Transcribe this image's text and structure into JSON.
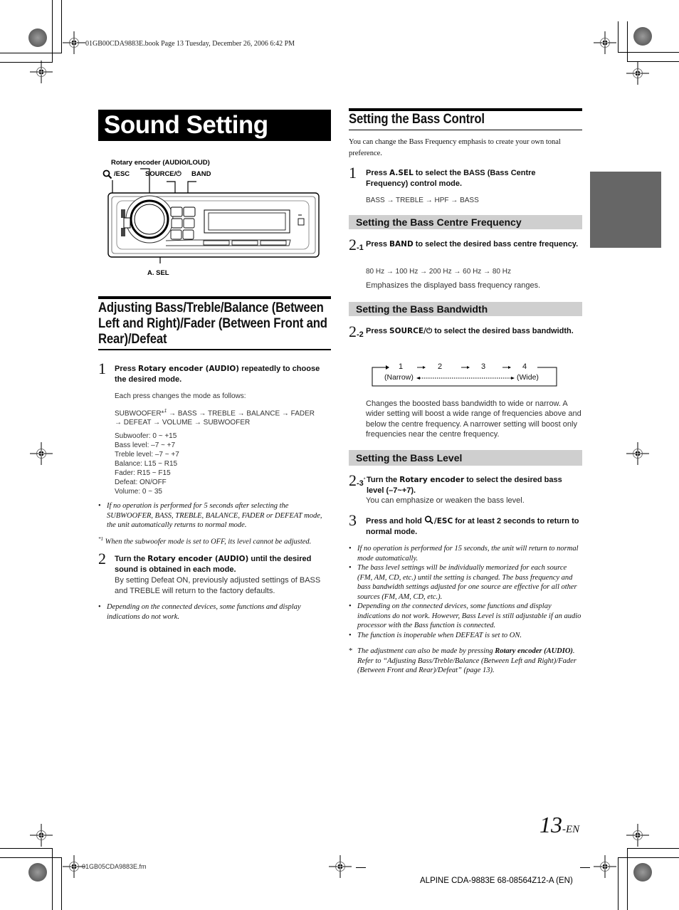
{
  "print_header": {
    "file_stamp": "01GB00CDA9883E.book  Page 13  Tuesday, December 26, 2006  6:42 PM"
  },
  "left": {
    "title": "Sound Setting",
    "diagram": {
      "labels": {
        "rotary": "Rotary encoder (AUDIO/LOUD)",
        "esc": "/ESC",
        "source": "SOURCE/⏻",
        "band": "BAND",
        "asel": "A. SEL"
      }
    },
    "section_heading": "Adjusting Bass/Treble/Balance (Between Left and Right)/Fader (Between Front and Rear)/Defeat",
    "step1": {
      "num": "1",
      "pre": "Press ",
      "key": "Rotary encoder (AUDIO)",
      "post": " repeatedly to choose the desired mode.",
      "intro": "Each press changes the mode as follows:",
      "sequence_line1": "SUBWOOFER*",
      "sequence_sup": "1",
      "sequence_rest": " → BASS → TREBLE → BALANCE → FADER",
      "sequence_line2": "→ DEFEAT → VOLUME → SUBWOOFER",
      "ranges": [
        "Subwoofer: 0 ~ +15",
        "Bass level: –7 ~ +7",
        "Treble level: –7 ~ +7",
        "Balance: L15 ~ R15",
        "Fader: R15 ~ F15",
        "Defeat: ON/OFF",
        "Volume: 0 ~ 35"
      ]
    },
    "note1": "If no operation is performed for 5 seconds after selecting the SUBWOOFER, BASS, TREBLE, BALANCE, FADER or DEFEAT mode, the unit automatically returns to normal mode.",
    "footnote_mark": "*1",
    "footnote": "When the subwoofer mode is set to OFF, its level cannot be adjusted.",
    "step2": {
      "num": "2",
      "pre": "Turn the ",
      "key": "Rotary encoder (AUDIO)",
      "post": " until the desired sound is obtained in each mode.",
      "desc": "By setting Defeat ON, previously adjusted settings of BASS and TREBLE will return to the factory defaults."
    },
    "note2": "Depending on the connected devices, some functions and display indications do not work."
  },
  "right": {
    "heading": "Setting the Bass Control",
    "intro": "You can change the Bass Frequency emphasis to create your own tonal preference.",
    "step1": {
      "num": "1",
      "pre": "Press ",
      "key": "A.SEL",
      "post": " to select the BASS (Bass Centre Frequency) control mode.",
      "sequence": "BASS → TREBLE → HPF → BASS"
    },
    "sub1": {
      "title": "Setting the Bass Centre Frequency",
      "num": "2",
      "suffix": "-1",
      "pre": "Press ",
      "key": "BAND",
      "post": " to select the desired bass centre frequency.",
      "sequence": "80 Hz → 100 Hz → 200 Hz → 60 Hz → 80 Hz",
      "desc": "Emphasizes the displayed bass frequency ranges."
    },
    "sub2": {
      "title": "Setting the Bass Bandwidth",
      "num": "2",
      "suffix": "-2",
      "pre": "Press ",
      "key": "SOURCE/⏻",
      "post": " to select the desired bass bandwidth.",
      "cycle": {
        "steps": [
          "1",
          "2",
          "3",
          "4"
        ],
        "narrow": "(Narrow)",
        "wide": "(Wide)"
      },
      "desc": "Changes the boosted bass bandwidth to wide or narrow. A wider setting will boost a wide range of frequencies above and below the centre frequency. A narrower setting will boost only frequencies near the centre frequency."
    },
    "sub3": {
      "title": "Setting the Bass Level",
      "num": "2",
      "suffix": "-3",
      "star": "*",
      "pre": "Turn the ",
      "key": "Rotary encoder",
      "post": " to select the desired bass level (–7~+7).",
      "desc": "You can emphasize or weaken the bass level."
    },
    "step3": {
      "num": "3",
      "pre": "Press and hold ",
      "key": "/ESC",
      "post": " for at least 2 seconds to return to normal mode."
    },
    "notes": [
      "If no operation is performed for 15 seconds, the unit will return to normal mode automatically.",
      "The bass level settings will be individually memorized for each source (FM, AM, CD, etc.) until the setting is changed. The bass frequency and bass bandwidth settings adjusted for one source are effective for all other sources (FM, AM, CD, etc.).",
      "Depending on the connected devices, some functions and display indications do not work. However, Bass Level is still adjustable if an audio processor with the Bass function is connected.",
      "The function is inoperable when DEFEAT is set to ON."
    ],
    "asterisk_note": {
      "mark": "*",
      "pre": "The adjustment can also be made by pressing ",
      "key": "Rotary encoder (AUDIO)",
      "post": ". Refer to “Adjusting Bass/Treble/Balance (Between Left and Right)/Fader (Between Front and Rear)/Defeat” (page 13)."
    }
  },
  "footer": {
    "page_number": "13",
    "page_suffix": "-EN",
    "fm_file": "01GB05CDA9883E.fm",
    "model": "ALPINE CDA-9883E 68-08564Z12-A (EN)"
  }
}
